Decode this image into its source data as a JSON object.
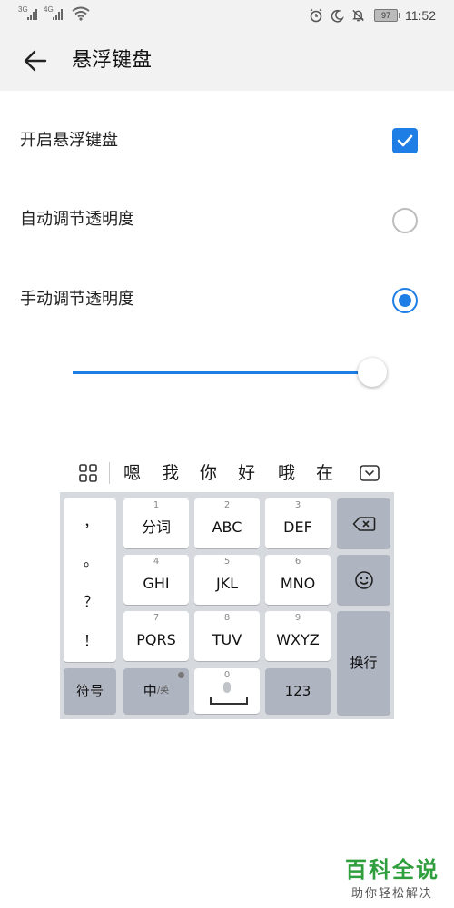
{
  "status_bar": {
    "sim1_net": "3G",
    "sim2_net": "4G",
    "battery": "97",
    "time": "11:52",
    "icons": [
      "alarm-icon",
      "moon-icon",
      "bell-off-icon",
      "battery-icon"
    ]
  },
  "header": {
    "back_icon": "arrow-left-icon",
    "title": "悬浮键盘"
  },
  "settings": {
    "enable_floating": {
      "label": "开启悬浮键盘",
      "checked": true
    },
    "auto_transparency": {
      "label": "自动调节透明度",
      "selected": false
    },
    "manual_transparency": {
      "label": "手动调节透明度",
      "selected": true
    }
  },
  "transparency_slider": {
    "value_fraction": 0.97
  },
  "keyboard": {
    "candidates": [
      "嗯",
      "我",
      "你",
      "好",
      "哦",
      "在"
    ],
    "punctuation": [
      "，",
      "。",
      "？",
      "！"
    ],
    "keys": [
      {
        "num": "1",
        "label": "分词"
      },
      {
        "num": "2",
        "label": "ABC"
      },
      {
        "num": "3",
        "label": "DEF"
      },
      {
        "num": "4",
        "label": "GHI"
      },
      {
        "num": "5",
        "label": "JKL"
      },
      {
        "num": "6",
        "label": "MNO"
      },
      {
        "num": "7",
        "label": "PQRS"
      },
      {
        "num": "8",
        "label": "TUV"
      },
      {
        "num": "9",
        "label": "WXYZ"
      }
    ],
    "symbols_label": "符号",
    "lang_main": "中",
    "lang_alt": "/英",
    "space_num": "0",
    "numbers_label": "123",
    "enter_label": "换行",
    "accent_color": "#1e7ee6"
  },
  "watermark": {
    "main": "百科全说",
    "sub": "助你轻松解决"
  }
}
